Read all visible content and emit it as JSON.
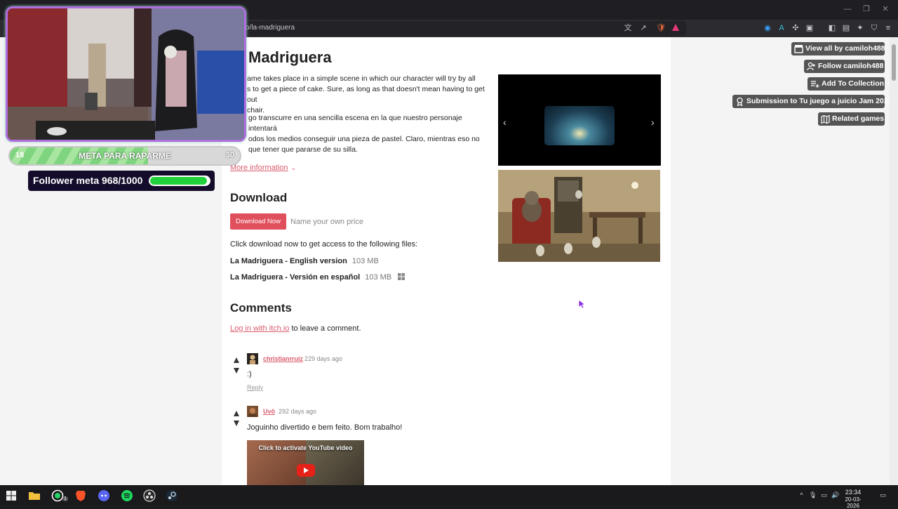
{
  "browser": {
    "url": "o/la-madriguera"
  },
  "game": {
    "title": "Madriguera",
    "desc_en": "ame takes place in a simple scene in which our character will try by all s to get a piece of cake. Sure, as long as that doesn't mean having to get out chair.",
    "desc_en_lines": [
      "ame takes place in a simple scene in which our character will try by all",
      "s to get a piece of cake. Sure, as long as that doesn't mean having to get out",
      "chair."
    ],
    "desc_es_lines": [
      "go transcurre en una sencilla escena en la que nuestro personaje intentará",
      "odos los medios conseguir una pieza de pastel. Claro, mientras eso no",
      "que tener que pararse de su silla."
    ],
    "more_info": "More information"
  },
  "download": {
    "heading": "Download",
    "button_label": "Download Now",
    "price_text": "Name your own price",
    "files_intro": "Click download now to get access to the following files:",
    "files": [
      {
        "name": "La Madriguera - English version",
        "size": "103 MB"
      },
      {
        "name": "La Madriguera - Versión en español",
        "size": "103 MB"
      }
    ]
  },
  "comments": {
    "heading": "Comments",
    "login_link": "Log in with itch.io",
    "login_suffix": " to leave a comment.",
    "items": [
      {
        "author": "christianrruiz",
        "time": "229 days ago",
        "body": ":)",
        "reply": "Reply"
      },
      {
        "author": "Uvô",
        "time": "292 days ago",
        "body": "Joguinho divertido e bem feito. Bom trabalho!"
      }
    ],
    "youtube_text": "Click to activate YouTube video"
  },
  "sidebar_buttons": [
    {
      "label": "View all by camiloh488",
      "icon": "store-icon"
    },
    {
      "label": "Follow camiloh488",
      "icon": "user-add-icon"
    },
    {
      "label": "Add To Collection",
      "icon": "add-list-icon"
    },
    {
      "label": "Submission to Tu juego a juicio Jam 2021",
      "icon": "award-icon"
    },
    {
      "label": "Related games",
      "icon": "map-icon"
    }
  ],
  "overlay": {
    "goal_min": "18",
    "goal_label": "META PARA RAPARME",
    "goal_max": "30",
    "goal_progress": 0.6,
    "follower_text": "Follower meta 968/1000",
    "follower_progress": 0.968
  },
  "taskbar": {
    "time": "23:34",
    "date": "20-03-2026",
    "whatsapp_badge": "1"
  },
  "colors": {
    "accent": "#da5b6d",
    "download_button": "#e0505c",
    "sidebar_button": "#555555",
    "overlay_border": "#b06dde",
    "follower_fill": "#21d13b"
  }
}
